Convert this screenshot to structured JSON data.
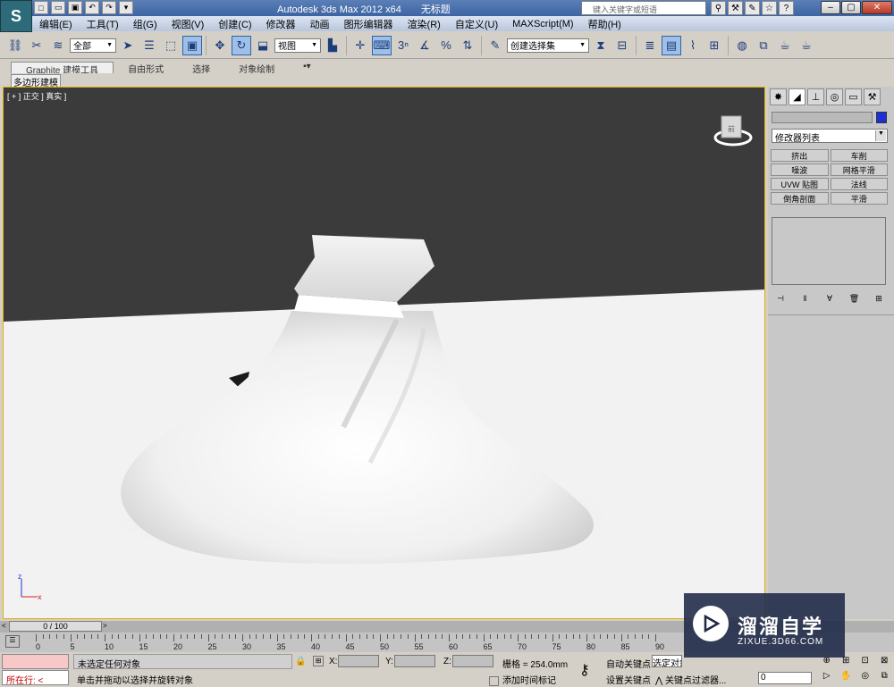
{
  "titlebar": {
    "app_title": "Autodesk 3ds Max  2012 x64",
    "doc_title": "无标题",
    "search_placeholder": "键入关键字或短语"
  },
  "menu": [
    "编辑(E)",
    "工具(T)",
    "组(G)",
    "视图(V)",
    "创建(C)",
    "修改器",
    "动画",
    "图形编辑器",
    "渲染(R)",
    "自定义(U)",
    "MAXScript(M)",
    "帮助(H)"
  ],
  "toolbar": {
    "selection_filter": "全部",
    "reference_coord": "视图",
    "named_selection": "创建选择集",
    "snap_label": "3",
    "percent_snap": "%"
  },
  "ribbon": {
    "tabs": [
      "Graphite 建模工具",
      "自由形式",
      "选择",
      "对象绘制"
    ],
    "panel_label": "多边形建模"
  },
  "viewport": {
    "label": "[ + ] 正交 ] 真实 ]",
    "viewcube_face": "前"
  },
  "command_panel": {
    "modifier_list": "修改器列表",
    "modifier_buttons": [
      "挤出",
      "车削",
      "噪波",
      "网格平滑",
      "UVW 贴图",
      "法线",
      "倒角剖面",
      "平滑"
    ],
    "object_color": "#1f2fd6"
  },
  "timeline": {
    "frame_counter": "0 / 100",
    "ticks": [
      "0",
      "5",
      "10",
      "15",
      "20",
      "25",
      "30",
      "35",
      "40",
      "45",
      "50",
      "55",
      "60",
      "65",
      "70",
      "75",
      "80",
      "85",
      "90"
    ]
  },
  "status": {
    "selection": "未选定任何对象",
    "running": "所在行: <",
    "prompt": "单击并拖动以选择并旋转对象",
    "x_label": "X:",
    "y_label": "Y:",
    "z_label": "Z:",
    "grid": "栅格 = 254.0mm",
    "add_time_tag": "添加时间标记",
    "auto_key": "自动关键点",
    "set_key": "设置关键点",
    "selected_dropdown": "选定对象",
    "key_filters": "关键点过滤器...",
    "frame_value": "0"
  },
  "watermark": {
    "title": "溜溜自学",
    "url": "ZIXUE.3D66.COM"
  }
}
